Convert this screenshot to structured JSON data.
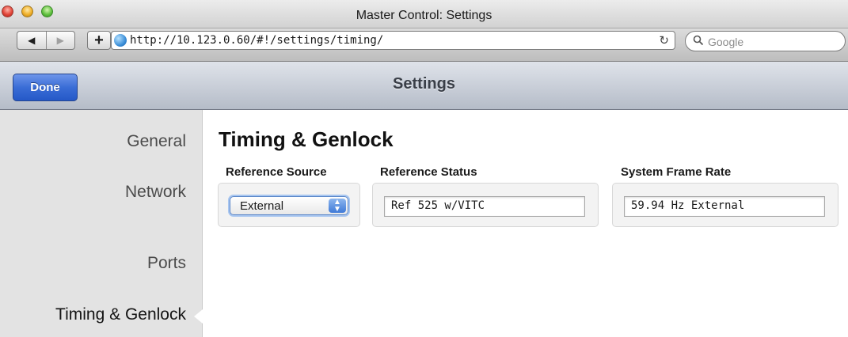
{
  "window": {
    "title": "Master Control: Settings"
  },
  "browser": {
    "back_icon": "back-arrow-icon",
    "forward_icon": "forward-arrow-icon",
    "add_label": "+",
    "url": "http://10.123.0.60/#!/settings/timing/",
    "reload_icon": "reload-icon",
    "search_placeholder": "Google"
  },
  "header": {
    "done_label": "Done",
    "title": "Settings"
  },
  "sidebar": {
    "items": [
      {
        "label": "General",
        "active": false
      },
      {
        "label": "Network",
        "active": false
      },
      {
        "label": "Ports",
        "active": false
      },
      {
        "label": "Timing & Genlock",
        "active": true
      }
    ]
  },
  "main": {
    "section_title": "Timing & Genlock",
    "fields": [
      {
        "label": "Reference Source",
        "type": "select",
        "value": "External"
      },
      {
        "label": "Reference Status",
        "type": "text",
        "value": "Ref 525 w/VITC"
      },
      {
        "label": "System Frame Rate",
        "type": "text",
        "value": "59.94 Hz External"
      }
    ]
  },
  "colors": {
    "done_button": "#3a6dd6",
    "header_gradient_top": "#dfe3ea",
    "sidebar_bg": "#e3e3e3"
  }
}
